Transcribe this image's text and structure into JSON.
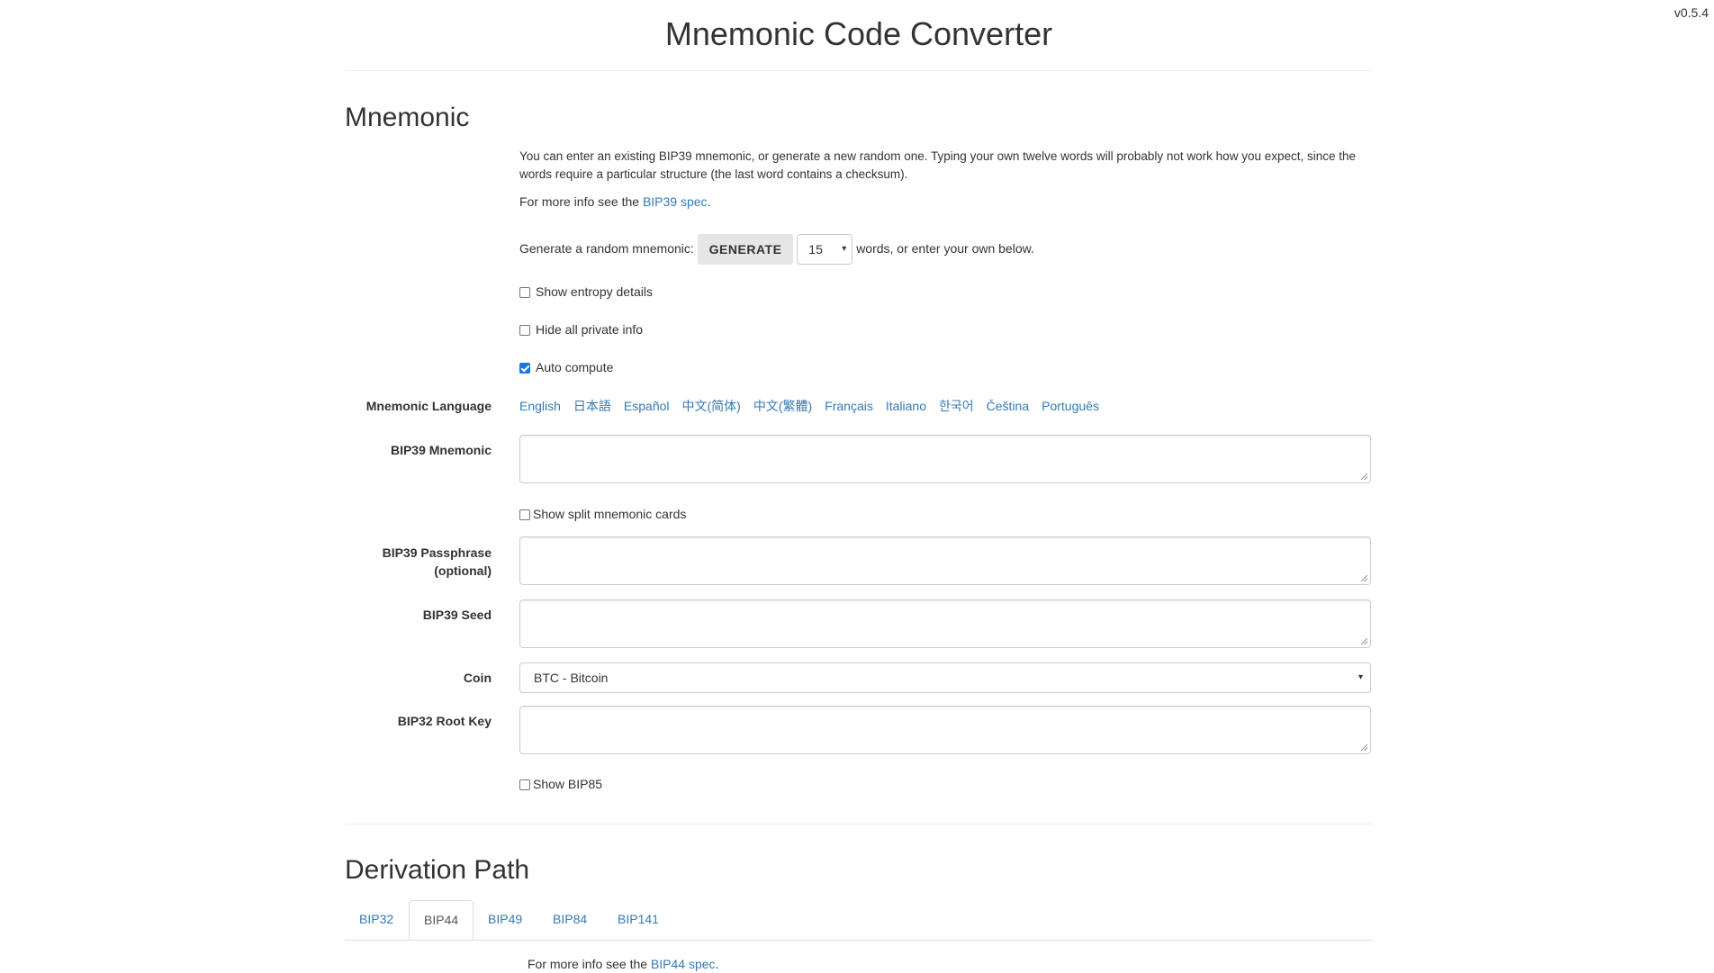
{
  "version": "v0.5.4",
  "title": "Mnemonic Code Converter",
  "mnemonic_section": {
    "heading": "Mnemonic",
    "intro": "You can enter an existing BIP39 mnemonic, or generate a new random one. Typing your own twelve words will probably not work how you expect, since the words require a particular structure (the last word contains a checksum).",
    "more_info_prefix": "For more info see the ",
    "more_info_link": "BIP39 spec",
    "more_info_suffix": ".",
    "generate_prefix": "Generate a random mnemonic:",
    "generate_button": "GENERATE",
    "word_count": "15",
    "generate_suffix": "words, or enter your own below.",
    "show_entropy": "Show entropy details",
    "hide_private": "Hide all private info",
    "auto_compute": "Auto compute",
    "language_label": "Mnemonic Language",
    "languages": [
      "English",
      "日本語",
      "Español",
      "中文(简体)",
      "中文(繁體)",
      "Français",
      "Italiano",
      "한국어",
      "Čeština",
      "Português"
    ],
    "bip39_mnemonic_label": "BIP39 Mnemonic",
    "show_split": "Show split mnemonic cards",
    "passphrase_label_1": "BIP39 Passphrase",
    "passphrase_label_2": "(optional)",
    "seed_label": "BIP39 Seed",
    "coin_label": "Coin",
    "coin_value": "BTC - Bitcoin",
    "root_key_label": "BIP32 Root Key",
    "show_bip85": "Show BIP85"
  },
  "derivation_section": {
    "heading": "Derivation Path",
    "tabs": [
      "BIP32",
      "BIP44",
      "BIP49",
      "BIP84",
      "BIP141"
    ],
    "active_tab": "BIP44",
    "more_info_prefix": "For more info see the ",
    "more_info_link": "BIP44 spec",
    "more_info_suffix": "."
  }
}
